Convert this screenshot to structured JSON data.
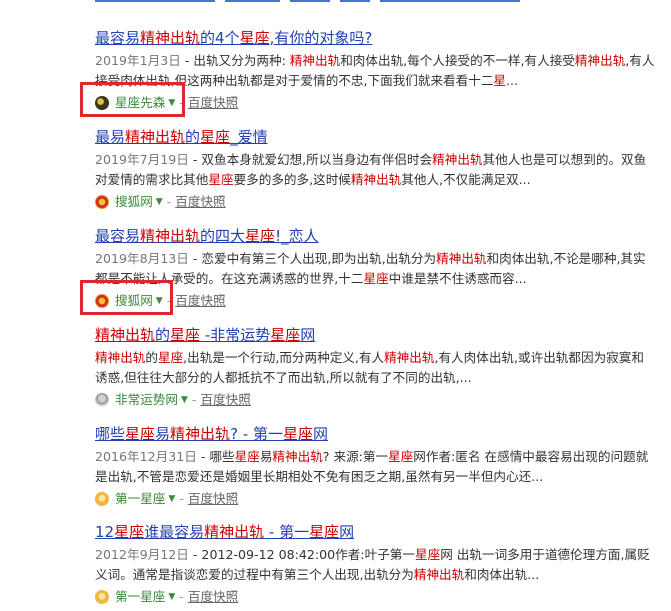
{
  "results": [
    {
      "title_parts": [
        {
          "t": "最容易",
          "e": false
        },
        {
          "t": "精神出轨",
          "e": true
        },
        {
          "t": "的4个",
          "e": false
        },
        {
          "t": "星座",
          "e": true
        },
        {
          "t": ",有你的对象吗?",
          "e": false
        }
      ],
      "date": "2019年1月3日",
      "abstract_parts": [
        {
          "t": " - 出轨又分为两种: ",
          "e": false
        },
        {
          "t": "精神出轨",
          "e": true
        },
        {
          "t": "和肉体出轨,每个人接受的不一样,有人接受",
          "e": false
        },
        {
          "t": "精神出轨",
          "e": true
        },
        {
          "t": ",有人接受肉体出轨,但这两种出轨都是对于爱情的不忠,下面我们就来看看十二",
          "e": false
        },
        {
          "t": "星",
          "e": true
        },
        {
          "t": "...",
          "e": false
        }
      ],
      "source": "星座先森",
      "snapshot": "百度快照",
      "icon": "star-sir-icon"
    },
    {
      "title_parts": [
        {
          "t": "最易",
          "e": false
        },
        {
          "t": "精神出轨",
          "e": true
        },
        {
          "t": "的",
          "e": false
        },
        {
          "t": "星座",
          "e": true
        },
        {
          "t": "_爱情",
          "e": false
        }
      ],
      "date": "2019年7月19日",
      "abstract_parts": [
        {
          "t": " - 双鱼本身就爱幻想,所以当身边有伴侣时会",
          "e": false
        },
        {
          "t": "精神出轨",
          "e": true
        },
        {
          "t": "其他人也是可以想到的。双鱼对爱情的需求比其他",
          "e": false
        },
        {
          "t": "星座",
          "e": true
        },
        {
          "t": "要多的多的多,这时候",
          "e": false
        },
        {
          "t": "精神出轨",
          "e": true
        },
        {
          "t": "其他人,不仅能满足双...",
          "e": false
        }
      ],
      "source": "搜狐网",
      "snapshot": "百度快照",
      "icon": "sohu-icon"
    },
    {
      "title_parts": [
        {
          "t": "最容易",
          "e": false
        },
        {
          "t": "精神出轨",
          "e": true
        },
        {
          "t": "的四大",
          "e": false
        },
        {
          "t": "星座",
          "e": true
        },
        {
          "t": "!_恋人",
          "e": false
        }
      ],
      "date": "2019年8月13日",
      "abstract_parts": [
        {
          "t": " - 恋爱中有第三个人出现,即为出轨,出轨分为",
          "e": false
        },
        {
          "t": "精神出轨",
          "e": true
        },
        {
          "t": "和肉体出轨,不论是哪种,其实都是不能让人承受的。在这充满诱惑的世界,十二",
          "e": false
        },
        {
          "t": "星座",
          "e": true
        },
        {
          "t": "中谁是禁不住诱惑而容...",
          "e": false
        }
      ],
      "source": "搜狐网",
      "snapshot": "百度快照",
      "icon": "sohu-icon"
    },
    {
      "title_parts": [
        {
          "t": "精神出轨",
          "e": true
        },
        {
          "t": "的",
          "e": false
        },
        {
          "t": "星座",
          "e": true
        },
        {
          "t": " -非常运势",
          "e": false
        },
        {
          "t": "星座",
          "e": true
        },
        {
          "t": "网",
          "e": false
        }
      ],
      "date": "",
      "abstract_parts": [
        {
          "t": "精神出轨",
          "e": true
        },
        {
          "t": "的",
          "e": false
        },
        {
          "t": "星座",
          "e": true
        },
        {
          "t": ",出轨是一个行动,而分两种定义,有人",
          "e": false
        },
        {
          "t": "精神出轨",
          "e": true
        },
        {
          "t": ",有人肉体出轨,或许出轨都因为寂寞和诱惑,但往往大部分的人都抵抗不了而出轨,所以就有了不同的出轨,...",
          "e": false
        }
      ],
      "source": "非常运势网",
      "snapshot": "百度快照",
      "icon": "fate-icon"
    },
    {
      "title_parts": [
        {
          "t": "哪些",
          "e": false
        },
        {
          "t": "星座",
          "e": true
        },
        {
          "t": "易",
          "e": false
        },
        {
          "t": "精神出轨",
          "e": true
        },
        {
          "t": "? - 第一",
          "e": false
        },
        {
          "t": "星座",
          "e": true
        },
        {
          "t": "网",
          "e": false
        }
      ],
      "date": "2016年12月31日",
      "abstract_parts": [
        {
          "t": " - 哪些",
          "e": false
        },
        {
          "t": "星座",
          "e": true
        },
        {
          "t": "易",
          "e": false
        },
        {
          "t": "精神出轨",
          "e": true
        },
        {
          "t": "? 来源:第一",
          "e": false
        },
        {
          "t": "星座",
          "e": true
        },
        {
          "t": "网作者:匿名 在感情中最容易出现的问题就是出轨,不管是恋爱还是婚姻里长期相处不免有困乏之期,虽然有另一半但内心还...",
          "e": false
        }
      ],
      "source": "第一星座",
      "snapshot": "百度快照",
      "icon": "first-star-icon"
    },
    {
      "title_parts": [
        {
          "t": "12",
          "e": false
        },
        {
          "t": "星座",
          "e": true
        },
        {
          "t": "谁最容易",
          "e": false
        },
        {
          "t": "精神出轨",
          "e": true
        },
        {
          "t": " - 第一",
          "e": false
        },
        {
          "t": "星座",
          "e": true
        },
        {
          "t": "网",
          "e": false
        }
      ],
      "date": "2012年9月12日",
      "abstract_parts": [
        {
          "t": " - 2012-09-12 08:42:00作者:叶子第一",
          "e": false
        },
        {
          "t": "星座",
          "e": true
        },
        {
          "t": "网 出轨一词多用于道德伦理方面,属贬义词。通常是指谈恋爱的过程中有第三个人出现,出轨分为",
          "e": false
        },
        {
          "t": "精神出轨",
          "e": true
        },
        {
          "t": "和肉体出轨...",
          "e": false
        }
      ],
      "source": "第一星座",
      "snapshot": "百度快照",
      "icon": "first-star-icon"
    }
  ],
  "colors": {
    "title": "#2440b3",
    "highlight": "#cc0000",
    "source": "#3a8a3a",
    "annotation_box": "#e0262f"
  }
}
